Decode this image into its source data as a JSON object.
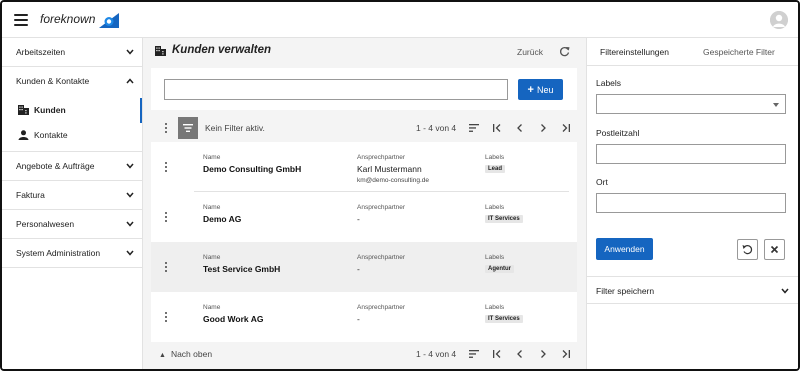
{
  "app": {
    "brand": "foreknown",
    "accent": "#1565c0"
  },
  "sidebar": {
    "sections": [
      {
        "label": "Arbeitszeiten",
        "expanded": false
      },
      {
        "label": "Kunden & Kontakte",
        "expanded": true
      },
      {
        "label": "Angebote & Aufträge",
        "expanded": false
      },
      {
        "label": "Faktura",
        "expanded": false
      },
      {
        "label": "Personalwesen",
        "expanded": false
      },
      {
        "label": "System Administration",
        "expanded": false
      }
    ],
    "subitems": [
      {
        "label": "Kunden",
        "icon": "building-icon",
        "active": true
      },
      {
        "label": "Kontakte",
        "icon": "person-icon",
        "active": false
      }
    ]
  },
  "main": {
    "title": "Kunden verwalten",
    "back_label": "Zurück",
    "search": {
      "value": "",
      "placeholder": ""
    },
    "new_label": "Neu",
    "filter_status": "Kein Filter aktiv.",
    "pagination": {
      "range_text": "1 - 4 von 4"
    },
    "scroll_top_label": "Nach oben",
    "field_labels": {
      "name": "Name",
      "contact": "Ansprechpartner",
      "labels": "Labels"
    },
    "rows": [
      {
        "name": "Demo Consulting GmbH",
        "contact": "Karl Mustermann",
        "email": "km@demo-consulting.de",
        "label": "Lead",
        "highlight": false
      },
      {
        "name": "Demo AG",
        "contact": "-",
        "email": "",
        "label": "IT Services",
        "highlight": false
      },
      {
        "name": "Test Service GmbH",
        "contact": "-",
        "email": "",
        "label": "Agentur",
        "highlight": true
      },
      {
        "name": "Good Work AG",
        "contact": "-",
        "email": "",
        "label": "IT Services",
        "highlight": false
      }
    ]
  },
  "filter_panel": {
    "tabs": [
      "Filtereinstellungen",
      "Gespeicherte Filter"
    ],
    "labels_label": "Labels",
    "labels_value": "",
    "postcode_label": "Postleitzahl",
    "postcode_value": "",
    "city_label": "Ort",
    "city_value": "",
    "apply_label": "Anwenden",
    "save_filter_label": "Filter speichern"
  }
}
